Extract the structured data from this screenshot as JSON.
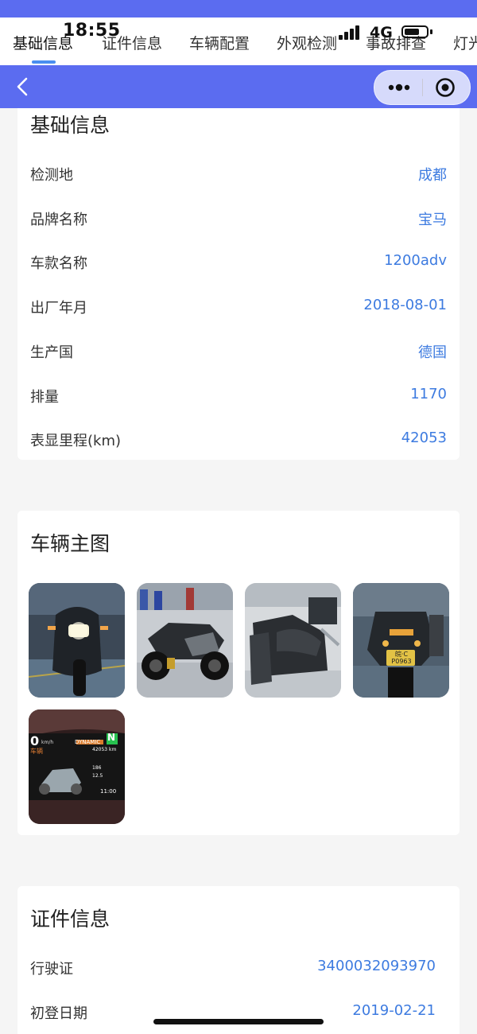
{
  "status": {
    "time": "18:55",
    "network": "4G"
  },
  "tabs": [
    "基础信息",
    "证件信息",
    "车辆配置",
    "外观检测",
    "事故排查",
    "灯光"
  ],
  "active_tab": "基础信息",
  "colors": {
    "brand": "#5b6cf0",
    "link": "#3d7be0",
    "accent": "#4a8ef0"
  },
  "basic_info": {
    "title": "基础信息",
    "rows": [
      {
        "label": "检测地",
        "value": "成都"
      },
      {
        "label": "品牌名称",
        "value": "宝马"
      },
      {
        "label": "车款名称",
        "value": "1200adv"
      },
      {
        "label": "出厂年月",
        "value": "2018-08-01"
      },
      {
        "label": "生产国",
        "value": "德国"
      },
      {
        "label": "排量",
        "value": "1170"
      },
      {
        "label": "表显里程(km)",
        "value": "42053"
      }
    ]
  },
  "main_photos": {
    "title": "车辆主图",
    "photos": [
      {
        "name": "front-view-photo"
      },
      {
        "name": "side-view-photo"
      },
      {
        "name": "seat-view-photo"
      },
      {
        "name": "rear-view-photo",
        "plate": "皖·C P0963"
      },
      {
        "name": "dashboard-photo",
        "speed": "0",
        "speed_unit": "km/h",
        "mode": "DYNAMIC",
        "gear": "N",
        "odometer": "42053 km",
        "trip_a": "186",
        "trip_b": "12.5",
        "clock": "11:00",
        "menu": "车辆"
      }
    ]
  },
  "certificate_info": {
    "title": "证件信息",
    "rows": [
      {
        "label": "行驶证",
        "value": "3400032093970"
      },
      {
        "label": "初登日期",
        "value": "2019-02-21"
      }
    ]
  }
}
